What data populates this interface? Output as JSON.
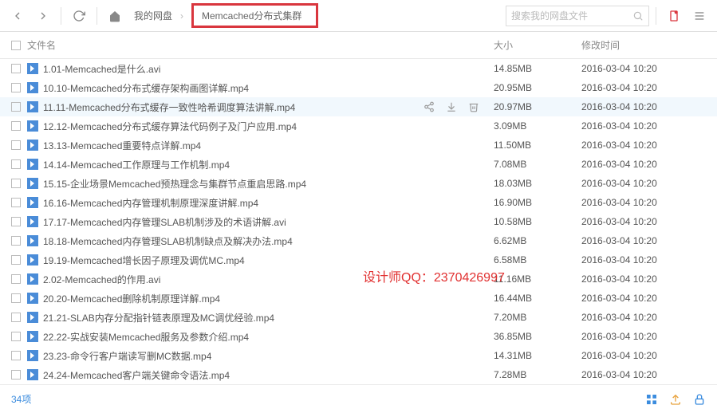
{
  "toolbar": {
    "breadcrumb_root": "我的网盘",
    "breadcrumb_current": "Memcached分布式集群",
    "search_placeholder": "搜索我的网盘文件"
  },
  "columns": {
    "name": "文件名",
    "size": "大小",
    "mtime": "修改时间"
  },
  "watermark": "设计师QQ：2370426997",
  "files": [
    {
      "name": "1.01-Memcached是什么.avi",
      "size": "14.85MB",
      "mtime": "2016-03-04 10:20"
    },
    {
      "name": "10.10-Memcached分布式缓存架构画图详解.mp4",
      "size": "20.95MB",
      "mtime": "2016-03-04 10:20"
    },
    {
      "name": "11.11-Memcached分布式缓存一致性哈希调度算法讲解.mp4",
      "size": "20.97MB",
      "mtime": "2016-03-04 10:20",
      "selected": true
    },
    {
      "name": "12.12-Memcached分布式缓存算法代码例子及门户应用.mp4",
      "size": "3.09MB",
      "mtime": "2016-03-04 10:20"
    },
    {
      "name": "13.13-Memcached重要特点详解.mp4",
      "size": "11.50MB",
      "mtime": "2016-03-04 10:20"
    },
    {
      "name": "14.14-Memcached工作原理与工作机制.mp4",
      "size": "7.08MB",
      "mtime": "2016-03-04 10:20"
    },
    {
      "name": "15.15-企业场景Memcached预热理念与集群节点重启思路.mp4",
      "size": "18.03MB",
      "mtime": "2016-03-04 10:20"
    },
    {
      "name": "16.16-Memcached内存管理机制原理深度讲解.mp4",
      "size": "16.90MB",
      "mtime": "2016-03-04 10:20"
    },
    {
      "name": "17.17-Memcached内存管理SLAB机制涉及的术语讲解.avi",
      "size": "10.58MB",
      "mtime": "2016-03-04 10:20"
    },
    {
      "name": "18.18-Memcached内存管理SLAB机制缺点及解决办法.mp4",
      "size": "6.62MB",
      "mtime": "2016-03-04 10:20"
    },
    {
      "name": "19.19-Memcached增长因子原理及调优MC.mp4",
      "size": "6.58MB",
      "mtime": "2016-03-04 10:20"
    },
    {
      "name": "2.02-Memcached的作用.avi",
      "size": "11.16MB",
      "mtime": "2016-03-04 10:20"
    },
    {
      "name": "20.20-Memcached删除机制原理详解.mp4",
      "size": "16.44MB",
      "mtime": "2016-03-04 10:20"
    },
    {
      "name": "21.21-SLAB内存分配指针链表原理及MC调优经验.mp4",
      "size": "7.20MB",
      "mtime": "2016-03-04 10:20"
    },
    {
      "name": "22.22-实战安装Memcached服务及参数介绍.mp4",
      "size": "36.85MB",
      "mtime": "2016-03-04 10:20"
    },
    {
      "name": "23.23-命令行客户端读写删MC数据.mp4",
      "size": "14.31MB",
      "mtime": "2016-03-04 10:20"
    },
    {
      "name": "24.24-Memcached客户端关键命令语法.mp4",
      "size": "7.28MB",
      "mtime": "2016-03-04 10:20"
    }
  ],
  "footer": {
    "count": "34项"
  }
}
